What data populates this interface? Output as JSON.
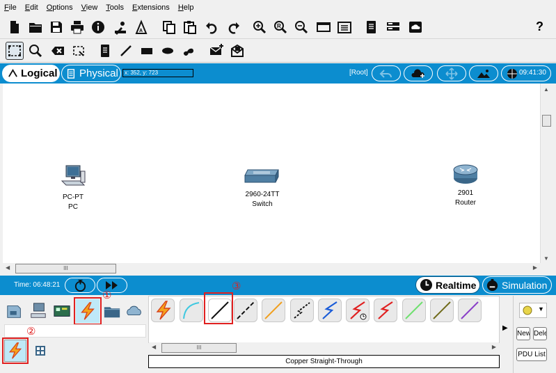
{
  "menu": [
    "File",
    "Edit",
    "Options",
    "View",
    "Tools",
    "Extensions",
    "Help"
  ],
  "toolbar": {
    "main_icons": [
      "new-file-icon",
      "open-folder-icon",
      "save-icon",
      "print-icon",
      "info-icon",
      "network-wizard-icon",
      "activity-wizard-icon",
      "copy-icon",
      "paste-icon",
      "undo-icon",
      "redo-icon",
      "zoom-in-icon",
      "zoom-reset-icon",
      "zoom-out-icon",
      "drawing-palette-icon",
      "custom-device-dialog-icon",
      "view-command-log-icon",
      "ipc-icon",
      "cloud-icon"
    ],
    "help_label": "?",
    "tool_icons": [
      "select-icon",
      "inspect-icon",
      "delete-icon",
      "resize-icon",
      "note-icon",
      "line-icon",
      "rectangle-icon",
      "ellipse-icon",
      "freeform-icon",
      "simple-pdu-icon",
      "complex-pdu-icon"
    ]
  },
  "logical_bar": {
    "logical_label": "Logical",
    "physical_label": "Physical",
    "coords": "x: 352, y: 723",
    "root_label": "[Root]",
    "clock": "09:41:30"
  },
  "devices": [
    {
      "model": "PC-PT",
      "name": "PC"
    },
    {
      "model": "2960-24TT",
      "name": "Switch"
    },
    {
      "model": "2901",
      "name": "Router"
    }
  ],
  "scroll": {
    "thumb_label": "III"
  },
  "bottom_bar": {
    "time_label": "Time: 06:48:21",
    "realtime_label": "Realtime",
    "simulation_label": "Simulation"
  },
  "annotations": [
    "①",
    "②",
    "③"
  ],
  "cables": {
    "selected_caption": "Copper Straight-Through",
    "items": [
      "automatic-connection-icon",
      "console-cable-icon",
      "copper-straight-through-icon",
      "copper-cross-over-icon",
      "fiber-icon",
      "phone-cable-icon",
      "coaxial-icon",
      "serial-dce-icon",
      "serial-dte-icon",
      "octal-cable-icon",
      "iot-custom-cable-icon",
      "usb-cable-icon"
    ]
  },
  "right_panel": {
    "new_label": "New",
    "delete_label": "Delete",
    "pdu_label": "PDU List"
  },
  "colors": {
    "accent_blue": "#0c8dcf",
    "annotation_red": "#e02020"
  }
}
